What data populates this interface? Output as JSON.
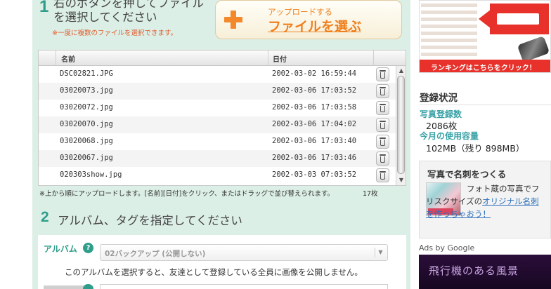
{
  "step1": {
    "number": "1",
    "title": "右のボタンを押してファイルを選択してください",
    "note": "※一度に複数のファイルを選択できます。",
    "upload_button": {
      "sub": "アップロードする",
      "main": "ファイルを選ぶ"
    }
  },
  "file_table": {
    "headers": {
      "name": "名前",
      "date": "日付"
    },
    "rows": [
      {
        "name": "DSC02821.JPG",
        "date": "2002-03-02 16:59:44"
      },
      {
        "name": "03020073.jpg",
        "date": "2002-03-06 17:03:52"
      },
      {
        "name": "03020072.jpg",
        "date": "2002-03-06 17:03:58"
      },
      {
        "name": "03020070.jpg",
        "date": "2002-03-06 17:04:02"
      },
      {
        "name": "03020068.jpg",
        "date": "2002-03-06 17:03:40"
      },
      {
        "name": "03020067.jpg",
        "date": "2002-03-06 17:03:46"
      },
      {
        "name": "020303show.jpg",
        "date": "2002-03-03 07:03:52"
      }
    ],
    "note": "※上から順にアップロードします。[名前][日付]をクリック、またはドラッグで並び替えられます。",
    "count": "17枚"
  },
  "step2": {
    "number": "2",
    "title": "アルバム、タグを指定してください",
    "album_label": "アルバム",
    "help_glyph": "?",
    "album_value": "02バックアップ (公開しない)",
    "album_desc": "このアルバムを選択すると、友達として登録している全員に画像を公開しません。"
  },
  "sidebar": {
    "banner_text": "ランキングはこちらをクリック！",
    "status_title": "登録状況",
    "photo_label": "写真登録数",
    "photo_count": "2086枚",
    "usage_label": "今月の使用容量",
    "usage_value": "102MB（残り 898MB）",
    "card": {
      "title": "写真で名刺をつくる",
      "text": "フォト蔵の写真でフリスクサイズの",
      "link": "オリジナル名刺を作っちゃおう！"
    },
    "ads_label": "Ads by Google",
    "ad_text": "飛行機のある風景"
  },
  "colors": {
    "mint_bg": "#dcefe6",
    "teal": "#2e9e8a",
    "orange": "#f0801e",
    "red": "#e7312a",
    "link": "#2a6ebb"
  },
  "icons": {
    "upload": "plus-icon",
    "delete": "trash-icon",
    "help": "help-icon"
  }
}
